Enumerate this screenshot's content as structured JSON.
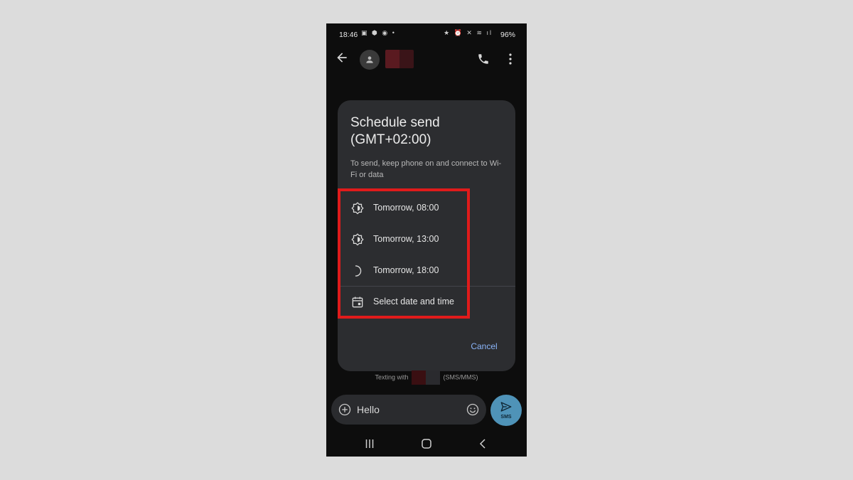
{
  "status_bar": {
    "time": "18:46",
    "battery": "96%",
    "left_icons": "▣ ⬢ ◉ •",
    "right_icons": "★ ⏰ ✕ ≋ ıl"
  },
  "dialog": {
    "title": "Schedule send (GMT+02:00)",
    "subtitle": "To send, keep phone on and connect to Wi-Fi or data",
    "options": [
      {
        "label": "Tomorrow, 08:00",
        "icon": "sun-partial-icon"
      },
      {
        "label": "Tomorrow, 13:00",
        "icon": "sun-icon"
      },
      {
        "label": "Tomorrow, 18:00",
        "icon": "moon-icon"
      },
      {
        "label": "Select date and time",
        "icon": "calendar-icon"
      }
    ],
    "cancel_label": "Cancel"
  },
  "texting_with": {
    "prefix": "Texting with",
    "suffix": "(SMS/MMS)"
  },
  "compose": {
    "message_value": "Hello",
    "send_label": "SMS"
  },
  "colors": {
    "accent": "#8ab4f8",
    "send_button": "#4f93b8",
    "highlight": "#e01b1b",
    "dialog_bg": "#2c2d30"
  }
}
